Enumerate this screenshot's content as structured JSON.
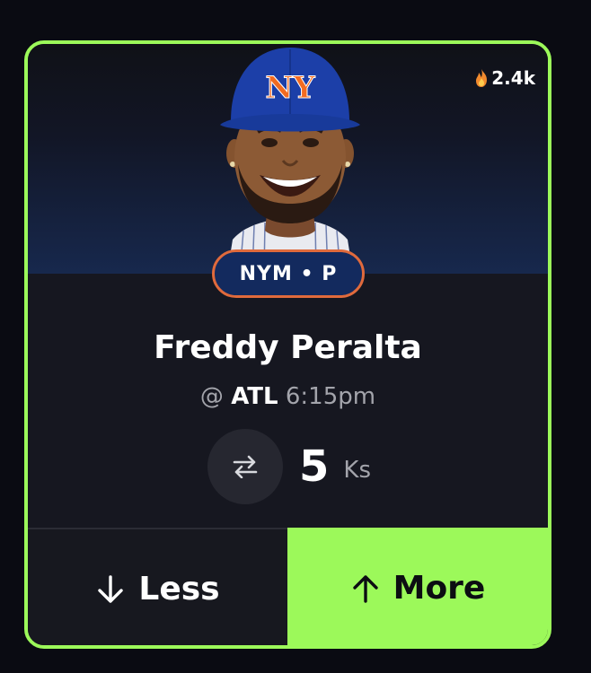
{
  "popularity": {
    "icon": "flame-icon",
    "count": "2.4k"
  },
  "player": {
    "name": "Freddy Peralta",
    "team_position": "NYM • P",
    "team_colors": {
      "primary": "#132a5e",
      "accent": "#e06a3c"
    }
  },
  "game": {
    "at": "@",
    "opponent": "ATL",
    "time": "6:15pm"
  },
  "projection": {
    "swap_icon": "swap-arrows-icon",
    "value": "5",
    "unit": "Ks"
  },
  "actions": {
    "less_label": "Less",
    "less_icon": "arrow-down-icon",
    "more_label": "More",
    "more_icon": "arrow-up-icon",
    "accent_color": "#9cf95a"
  }
}
